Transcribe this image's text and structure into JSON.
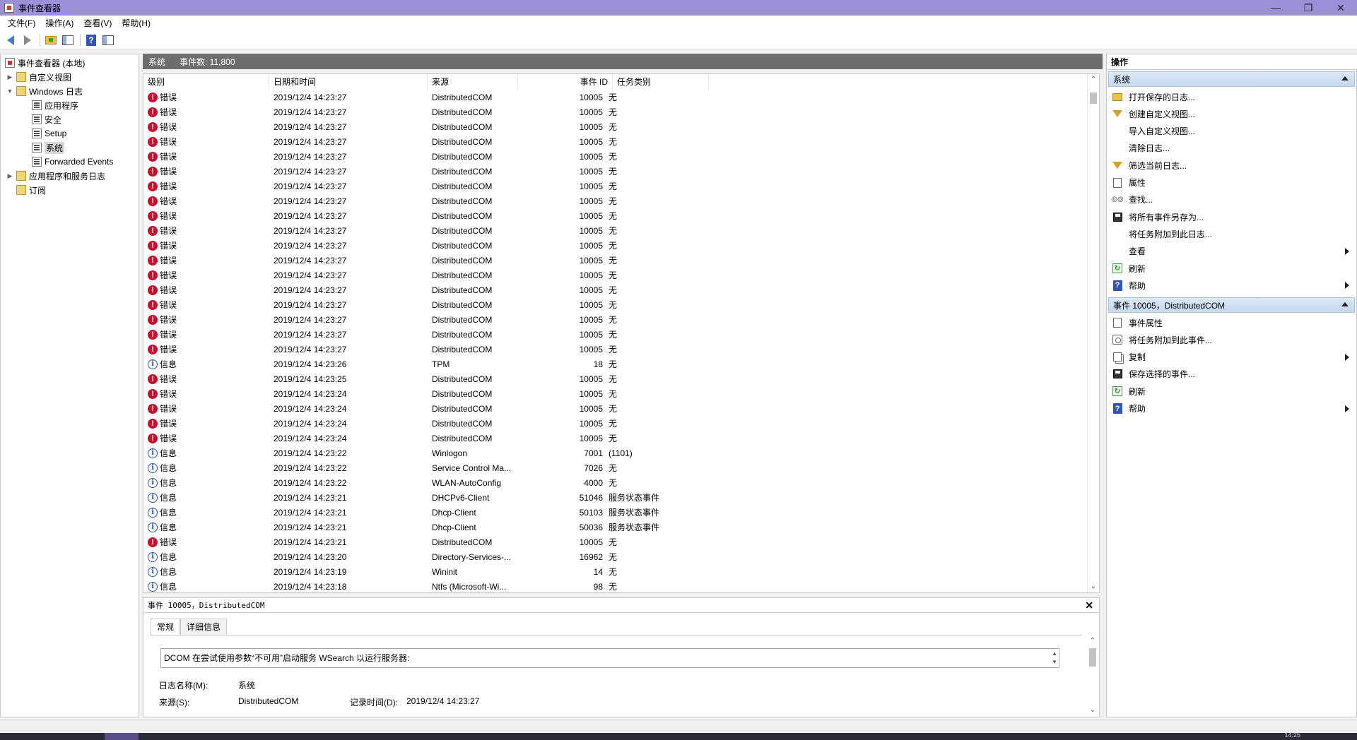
{
  "window": {
    "title": "事件查看器",
    "minimize": "—",
    "maximize": "❐",
    "close": "✕"
  },
  "menu": [
    "文件(F)",
    "操作(A)",
    "查看(V)",
    "帮助(H)"
  ],
  "tree": {
    "root": "事件查看器 (本地)",
    "custom_views": "自定义视图",
    "windows_logs": "Windows 日志",
    "application": "应用程序",
    "security": "安全",
    "setup": "Setup",
    "system": "系统",
    "forwarded": "Forwarded Events",
    "app_service_logs": "应用程序和服务日志",
    "subscriptions": "订阅"
  },
  "center": {
    "log_name": "系统",
    "event_count": "事件数: 11,800"
  },
  "table": {
    "headers": {
      "level": "级别",
      "date": "日期和时间",
      "source": "来源",
      "event_id": "事件 ID",
      "task": "任务类别"
    },
    "rows": [
      {
        "level": "错误",
        "type": "error",
        "date": "2019/12/4 14:23:27",
        "source": "DistributedCOM",
        "id": "10005",
        "task": "无"
      },
      {
        "level": "错误",
        "type": "error",
        "date": "2019/12/4 14:23:27",
        "source": "DistributedCOM",
        "id": "10005",
        "task": "无"
      },
      {
        "level": "错误",
        "type": "error",
        "date": "2019/12/4 14:23:27",
        "source": "DistributedCOM",
        "id": "10005",
        "task": "无"
      },
      {
        "level": "错误",
        "type": "error",
        "date": "2019/12/4 14:23:27",
        "source": "DistributedCOM",
        "id": "10005",
        "task": "无"
      },
      {
        "level": "错误",
        "type": "error",
        "date": "2019/12/4 14:23:27",
        "source": "DistributedCOM",
        "id": "10005",
        "task": "无"
      },
      {
        "level": "错误",
        "type": "error",
        "date": "2019/12/4 14:23:27",
        "source": "DistributedCOM",
        "id": "10005",
        "task": "无"
      },
      {
        "level": "错误",
        "type": "error",
        "date": "2019/12/4 14:23:27",
        "source": "DistributedCOM",
        "id": "10005",
        "task": "无"
      },
      {
        "level": "错误",
        "type": "error",
        "date": "2019/12/4 14:23:27",
        "source": "DistributedCOM",
        "id": "10005",
        "task": "无"
      },
      {
        "level": "错误",
        "type": "error",
        "date": "2019/12/4 14:23:27",
        "source": "DistributedCOM",
        "id": "10005",
        "task": "无"
      },
      {
        "level": "错误",
        "type": "error",
        "date": "2019/12/4 14:23:27",
        "source": "DistributedCOM",
        "id": "10005",
        "task": "无"
      },
      {
        "level": "错误",
        "type": "error",
        "date": "2019/12/4 14:23:27",
        "source": "DistributedCOM",
        "id": "10005",
        "task": "无"
      },
      {
        "level": "错误",
        "type": "error",
        "date": "2019/12/4 14:23:27",
        "source": "DistributedCOM",
        "id": "10005",
        "task": "无"
      },
      {
        "level": "错误",
        "type": "error",
        "date": "2019/12/4 14:23:27",
        "source": "DistributedCOM",
        "id": "10005",
        "task": "无"
      },
      {
        "level": "错误",
        "type": "error",
        "date": "2019/12/4 14:23:27",
        "source": "DistributedCOM",
        "id": "10005",
        "task": "无"
      },
      {
        "level": "错误",
        "type": "error",
        "date": "2019/12/4 14:23:27",
        "source": "DistributedCOM",
        "id": "10005",
        "task": "无"
      },
      {
        "level": "错误",
        "type": "error",
        "date": "2019/12/4 14:23:27",
        "source": "DistributedCOM",
        "id": "10005",
        "task": "无"
      },
      {
        "level": "错误",
        "type": "error",
        "date": "2019/12/4 14:23:27",
        "source": "DistributedCOM",
        "id": "10005",
        "task": "无"
      },
      {
        "level": "错误",
        "type": "error",
        "date": "2019/12/4 14:23:27",
        "source": "DistributedCOM",
        "id": "10005",
        "task": "无"
      },
      {
        "level": "信息",
        "type": "info",
        "date": "2019/12/4 14:23:26",
        "source": "TPM",
        "id": "18",
        "task": "无"
      },
      {
        "level": "错误",
        "type": "error",
        "date": "2019/12/4 14:23:25",
        "source": "DistributedCOM",
        "id": "10005",
        "task": "无"
      },
      {
        "level": "错误",
        "type": "error",
        "date": "2019/12/4 14:23:24",
        "source": "DistributedCOM",
        "id": "10005",
        "task": "无"
      },
      {
        "level": "错误",
        "type": "error",
        "date": "2019/12/4 14:23:24",
        "source": "DistributedCOM",
        "id": "10005",
        "task": "无"
      },
      {
        "level": "错误",
        "type": "error",
        "date": "2019/12/4 14:23:24",
        "source": "DistributedCOM",
        "id": "10005",
        "task": "无"
      },
      {
        "level": "错误",
        "type": "error",
        "date": "2019/12/4 14:23:24",
        "source": "DistributedCOM",
        "id": "10005",
        "task": "无"
      },
      {
        "level": "信息",
        "type": "info",
        "date": "2019/12/4 14:23:22",
        "source": "Winlogon",
        "id": "7001",
        "task": "(1101)"
      },
      {
        "level": "信息",
        "type": "info",
        "date": "2019/12/4 14:23:22",
        "source": "Service Control Ma...",
        "id": "7026",
        "task": "无"
      },
      {
        "level": "信息",
        "type": "info",
        "date": "2019/12/4 14:23:22",
        "source": "WLAN-AutoConfig",
        "id": "4000",
        "task": "无"
      },
      {
        "level": "信息",
        "type": "info",
        "date": "2019/12/4 14:23:21",
        "source": "DHCPv6-Client",
        "id": "51046",
        "task": "服务状态事件"
      },
      {
        "level": "信息",
        "type": "info",
        "date": "2019/12/4 14:23:21",
        "source": "Dhcp-Client",
        "id": "50103",
        "task": "服务状态事件"
      },
      {
        "level": "信息",
        "type": "info",
        "date": "2019/12/4 14:23:21",
        "source": "Dhcp-Client",
        "id": "50036",
        "task": "服务状态事件"
      },
      {
        "level": "错误",
        "type": "error",
        "date": "2019/12/4 14:23:21",
        "source": "DistributedCOM",
        "id": "10005",
        "task": "无"
      },
      {
        "level": "信息",
        "type": "info",
        "date": "2019/12/4 14:23:20",
        "source": "Directory-Services-...",
        "id": "16962",
        "task": "无"
      },
      {
        "level": "信息",
        "type": "info",
        "date": "2019/12/4 14:23:19",
        "source": "Wininit",
        "id": "14",
        "task": "无"
      },
      {
        "level": "信息",
        "type": "info",
        "date": "2019/12/4 14:23:18",
        "source": "Ntfs (Microsoft-Wi...",
        "id": "98",
        "task": "无"
      }
    ]
  },
  "detail": {
    "title": "事件 10005，DistributedCOM",
    "close": "✕",
    "tab_general": "常规",
    "tab_details": "详细信息",
    "message": "DCOM 在尝试使用参数“不可用”启动服务 WSearch 以运行服务器:",
    "log_name_label": "日志名称(M):",
    "log_name_value": "系统",
    "source_label": "来源(S):",
    "source_value": "DistributedCOM",
    "logged_label": "记录时间(D):",
    "logged_value": "2019/12/4 14:23:27"
  },
  "actions": {
    "title": "操作",
    "section_system": "系统",
    "system_items": [
      {
        "label": "打开保存的日志...",
        "icon": "open-log-icon"
      },
      {
        "label": "创建自定义视图...",
        "icon": "filter-icon"
      },
      {
        "label": "导入自定义视图...",
        "icon": ""
      },
      {
        "label": "清除日志...",
        "icon": ""
      },
      {
        "label": "筛选当前日志...",
        "icon": "filter-icon"
      },
      {
        "label": "属性",
        "icon": "properties-icon"
      },
      {
        "label": "查找...",
        "icon": "find-icon"
      },
      {
        "label": "将所有事件另存为...",
        "icon": "save-icon"
      },
      {
        "label": "将任务附加到此日志...",
        "icon": ""
      },
      {
        "label": "查看",
        "icon": "",
        "submenu": true
      },
      {
        "label": "刷新",
        "icon": "refresh-icon"
      },
      {
        "label": "帮助",
        "icon": "help-icon",
        "submenu": true
      }
    ],
    "section_event": "事件 10005，DistributedCOM",
    "event_items": [
      {
        "label": "事件属性",
        "icon": "properties-icon"
      },
      {
        "label": "将任务附加到此事件...",
        "icon": "task-icon"
      },
      {
        "label": "复制",
        "icon": "copy-icon",
        "submenu": true
      },
      {
        "label": "保存选择的事件...",
        "icon": "save-icon"
      },
      {
        "label": "刷新",
        "icon": "refresh-icon"
      },
      {
        "label": "帮助",
        "icon": "help-icon",
        "submenu": true
      }
    ]
  },
  "taskbar": {
    "clock": "14:25"
  }
}
